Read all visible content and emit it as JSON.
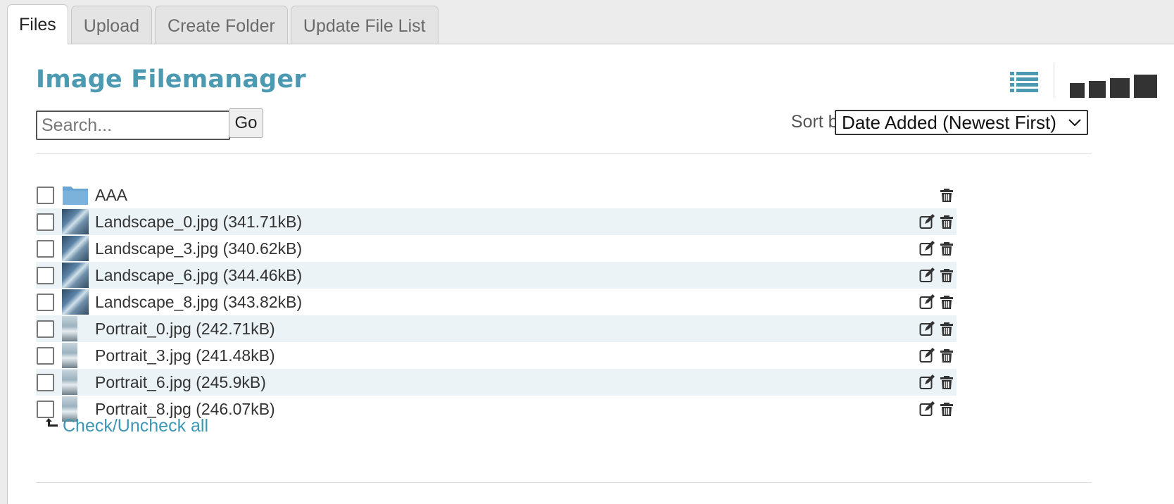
{
  "tabs": [
    {
      "label": "Files",
      "active": true
    },
    {
      "label": "Upload",
      "active": false
    },
    {
      "label": "Create Folder",
      "active": false
    },
    {
      "label": "Update File List",
      "active": false
    }
  ],
  "header": {
    "title": "Image Filemanager",
    "view_icons": [
      "list-view-icon",
      "thumb-size-1",
      "thumb-size-2",
      "thumb-size-3",
      "thumb-size-4"
    ]
  },
  "search": {
    "placeholder": "Search...",
    "value": "",
    "go_label": "Go"
  },
  "sort": {
    "label": "Sort by",
    "selected": "Date Added (Newest First)"
  },
  "files": [
    {
      "name": "AAA",
      "type": "folder",
      "actions": [
        "delete"
      ]
    },
    {
      "name": "Landscape_0.jpg (341.71kB)",
      "type": "landscape",
      "actions": [
        "edit",
        "delete"
      ]
    },
    {
      "name": "Landscape_3.jpg (340.62kB)",
      "type": "landscape",
      "actions": [
        "edit",
        "delete"
      ]
    },
    {
      "name": "Landscape_6.jpg (344.46kB)",
      "type": "landscape",
      "actions": [
        "edit",
        "delete"
      ]
    },
    {
      "name": "Landscape_8.jpg (343.82kB)",
      "type": "landscape",
      "actions": [
        "edit",
        "delete"
      ]
    },
    {
      "name": "Portrait_0.jpg (242.71kB)",
      "type": "portrait",
      "actions": [
        "edit",
        "delete"
      ]
    },
    {
      "name": "Portrait_3.jpg (241.48kB)",
      "type": "portrait",
      "actions": [
        "edit",
        "delete"
      ]
    },
    {
      "name": "Portrait_6.jpg (245.9kB)",
      "type": "portrait",
      "actions": [
        "edit",
        "delete"
      ]
    },
    {
      "name": "Portrait_8.jpg (246.07kB)",
      "type": "portrait",
      "actions": [
        "edit",
        "delete"
      ]
    }
  ],
  "footer": {
    "check_all_label": "Check/Uncheck all"
  },
  "colors": {
    "accent": "#4b9ab1",
    "link": "#3e97b4",
    "row_alt": "#ebf3f7",
    "folder": "#6aa6d4"
  }
}
